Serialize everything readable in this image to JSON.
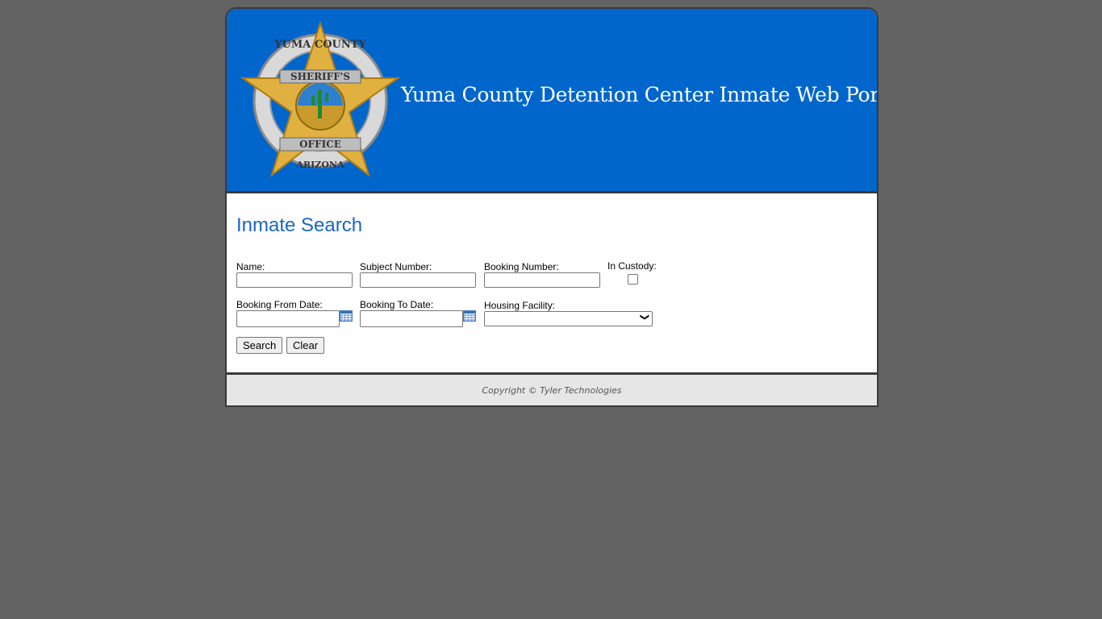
{
  "header": {
    "title": "Yuma County Detention Center Inmate Web Portal",
    "logo_text": "YUMA COUNTY SHERIFF'S OFFICE ARIZONA",
    "colors": {
      "header_bg": "#0066cc",
      "heading": "#1a66c4"
    }
  },
  "search": {
    "heading": "Inmate Search",
    "name_label": "Name:",
    "name_value": "",
    "subject_label": "Subject Number:",
    "subject_value": "",
    "booking_label": "Booking Number:",
    "booking_value": "",
    "custody_label": "In Custody:",
    "custody_checked": false,
    "from_label": "Booking From Date:",
    "from_value": "",
    "to_label": "Booking To Date:",
    "to_value": "",
    "facility_label": "Housing Facility:",
    "facility_selected": "",
    "search_button": "Search",
    "clear_button": "Clear",
    "calendar_icon": "calendar-icon"
  },
  "footer": {
    "copyright": "Copyright © Tyler Technologies"
  }
}
